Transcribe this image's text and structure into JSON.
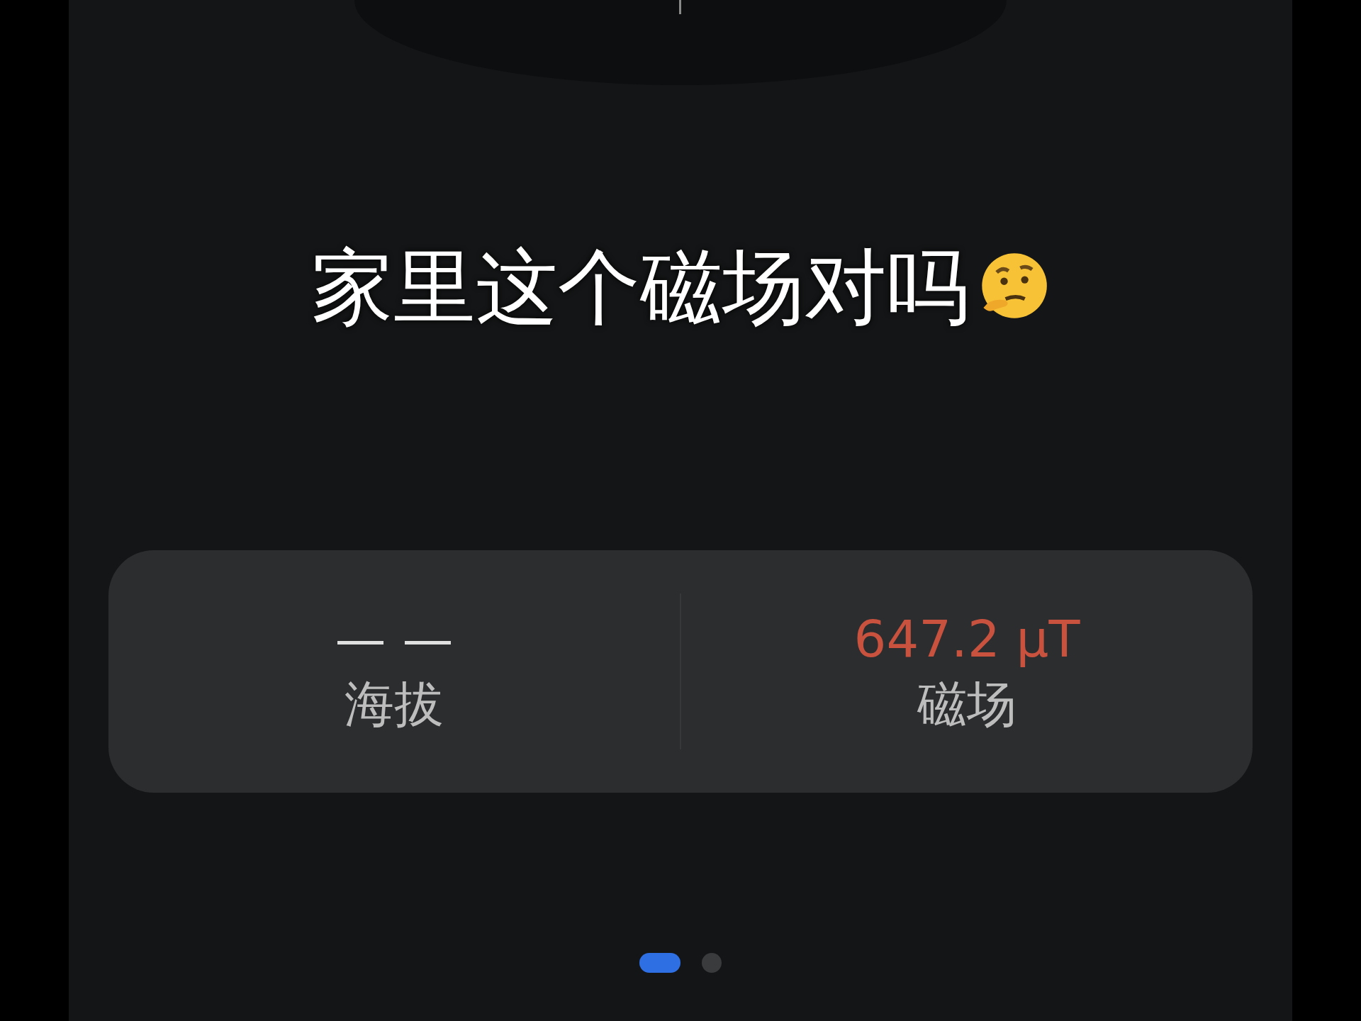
{
  "caption": {
    "text": "家里这个磁场对吗"
  },
  "stats": [
    {
      "value": "— —",
      "label": "海拔",
      "color": "#e0e0e0"
    },
    {
      "value": "647.2 μT",
      "label": "磁场",
      "color": "#c9523f"
    }
  ],
  "pages": [
    {
      "selected": true
    },
    {
      "selected": false
    }
  ]
}
